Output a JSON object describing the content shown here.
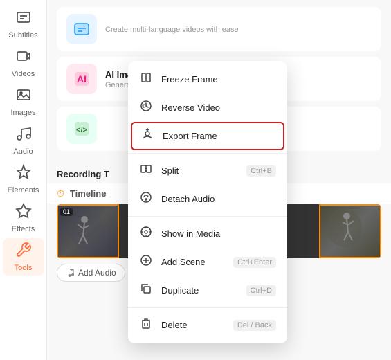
{
  "sidebar": {
    "items": [
      {
        "id": "subtitles",
        "label": "Subtitles",
        "icon": "💬"
      },
      {
        "id": "videos",
        "label": "Videos",
        "icon": "🎬"
      },
      {
        "id": "images",
        "label": "Images",
        "icon": "🖼️"
      },
      {
        "id": "audio",
        "label": "Audio",
        "icon": "🎵"
      },
      {
        "id": "elements",
        "label": "Elements",
        "icon": "✦"
      },
      {
        "id": "effects",
        "label": "Effects",
        "icon": "⭐"
      },
      {
        "id": "tools",
        "label": "Tools",
        "icon": "🔧"
      }
    ]
  },
  "cards": [
    {
      "id": "subtitles-card",
      "icon": "💬",
      "icon_bg": "blue",
      "title": "",
      "desc": "Create multi-language videos with ease"
    },
    {
      "id": "ai-image",
      "icon": "🤖",
      "icon_bg": "pink",
      "title": "AI Image Generator",
      "desc": "Generate images in various styles"
    },
    {
      "id": "code-card",
      "icon": "</>",
      "icon_bg": "green",
      "title": "",
      "desc": ""
    }
  ],
  "section_header": "Recording T",
  "timeline_label": "Timeline",
  "timeline_icon": "⏱",
  "add_audio_label": "Add Audio",
  "context_menu": {
    "items": [
      {
        "id": "freeze-frame",
        "label": "Freeze Frame",
        "shortcut": "",
        "icon": "⏸",
        "highlighted": false
      },
      {
        "id": "reverse-video",
        "label": "Reverse Video",
        "shortcut": "",
        "icon": "🔄",
        "highlighted": false
      },
      {
        "id": "export-frame",
        "label": "Export Frame",
        "shortcut": "",
        "icon": "🖼",
        "highlighted": true
      },
      {
        "id": "split",
        "label": "Split",
        "shortcut": "Ctrl+B",
        "icon": "✂",
        "highlighted": false
      },
      {
        "id": "detach-audio",
        "label": "Detach Audio",
        "shortcut": "",
        "icon": "🎵",
        "highlighted": false
      },
      {
        "id": "show-in-media",
        "label": "Show in Media",
        "shortcut": "",
        "icon": "📍",
        "highlighted": false
      },
      {
        "id": "add-scene",
        "label": "Add Scene",
        "shortcut": "Ctrl+Enter",
        "icon": "➕",
        "highlighted": false
      },
      {
        "id": "duplicate",
        "label": "Duplicate",
        "shortcut": "Ctrl+D",
        "icon": "⧉",
        "highlighted": false
      },
      {
        "id": "delete",
        "label": "Delete",
        "shortcut": "Del / Back",
        "icon": "🗑",
        "highlighted": false
      }
    ]
  }
}
